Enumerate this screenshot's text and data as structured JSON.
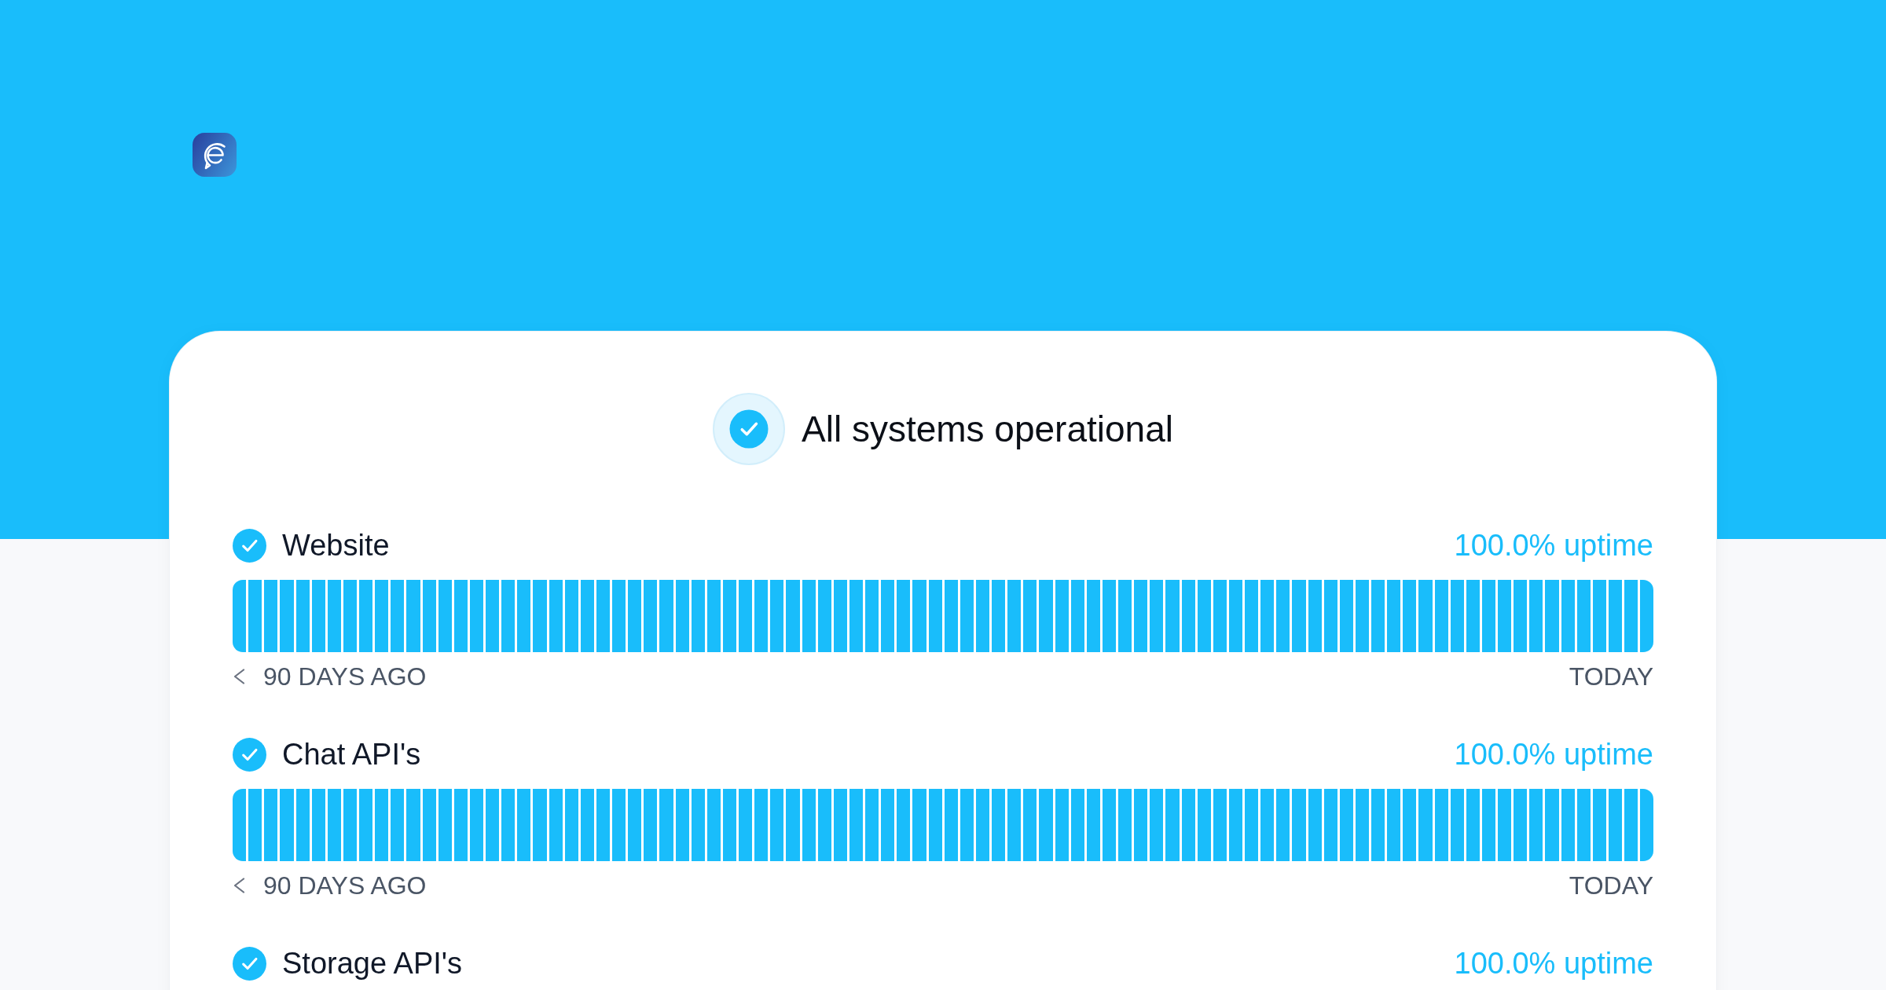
{
  "overall": {
    "title": "All systems operational",
    "operational": true
  },
  "components": [
    {
      "name": "Website",
      "operational": true,
      "uptime": "100.0% uptime",
      "range_start": "90 DAYS AGO",
      "range_end": "TODAY"
    },
    {
      "name": "Chat API's",
      "operational": true,
      "uptime": "100.0% uptime",
      "range_start": "90 DAYS AGO",
      "range_end": "TODAY"
    },
    {
      "name": "Storage API's",
      "operational": true,
      "uptime": "100.0% uptime"
    }
  ]
}
